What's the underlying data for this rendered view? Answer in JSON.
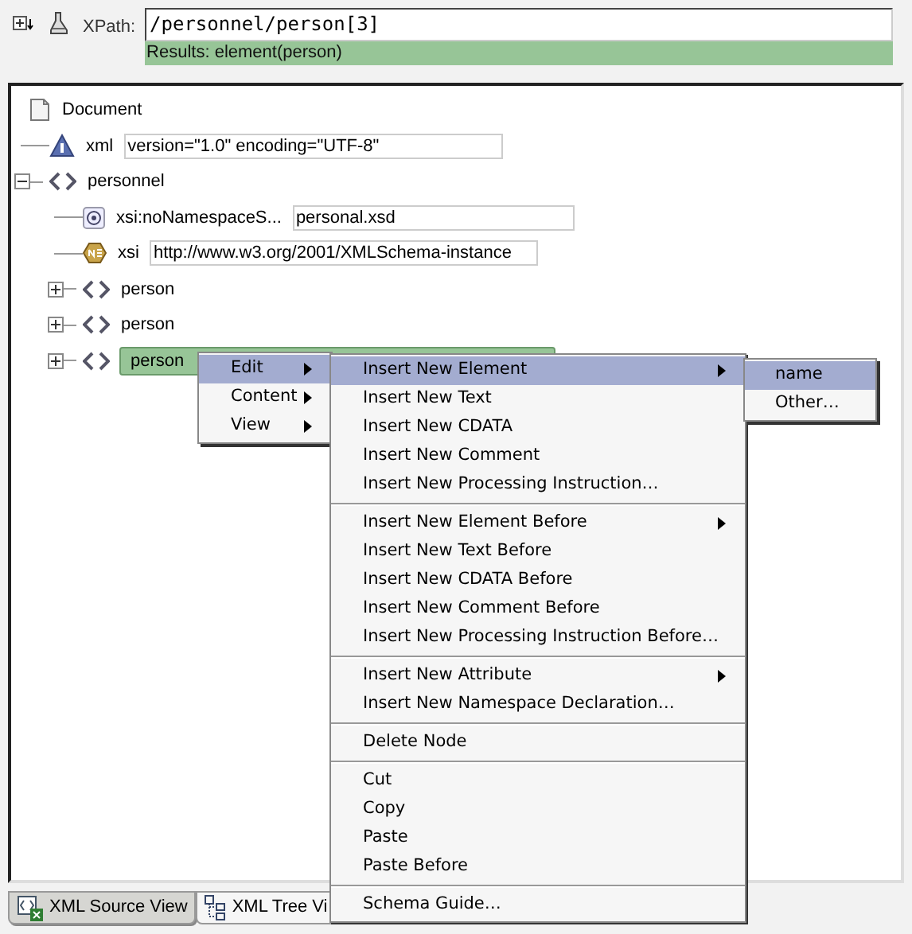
{
  "toolbar": {
    "xpath_label": "XPath:",
    "xpath_value": "/personnel/person[3]",
    "results": "Results: element(person)"
  },
  "tree": [
    {
      "kind": "document",
      "label": "Document",
      "selected": false,
      "children": [
        {
          "kind": "pi",
          "label": "xml",
          "value": "version=\"1.0\" encoding=\"UTF-8\"",
          "selected": false
        },
        {
          "kind": "element",
          "label": "personnel",
          "expanded": true,
          "selected": false,
          "children": [
            {
              "kind": "attribute",
              "label": "xsi:noNamespaceS...",
              "value": "personal.xsd",
              "selected": false
            },
            {
              "kind": "namespace",
              "label": "xsi",
              "value": "http://www.w3.org/2001/XMLSchema-instance",
              "selected": false
            },
            {
              "kind": "element",
              "label": "person",
              "expanded": false,
              "selected": false
            },
            {
              "kind": "element",
              "label": "person",
              "expanded": false,
              "selected": false
            },
            {
              "kind": "element",
              "label": "person",
              "expanded": false,
              "selected": true
            }
          ]
        }
      ]
    }
  ],
  "context_menu": [
    {
      "label": "Edit",
      "has_submenu": true,
      "selected": true
    },
    {
      "label": "Content",
      "has_submenu": true,
      "selected": false
    },
    {
      "label": "View",
      "has_submenu": true,
      "selected": false
    }
  ],
  "submenu": [
    {
      "label": "Insert New Element",
      "has_submenu": true,
      "selected": true,
      "separator_before": false
    },
    {
      "label": "Insert New Text",
      "has_submenu": false,
      "selected": false,
      "separator_before": false
    },
    {
      "label": "Insert New CDATA",
      "has_submenu": false,
      "selected": false,
      "separator_before": false
    },
    {
      "label": "Insert New Comment",
      "has_submenu": false,
      "selected": false,
      "separator_before": false
    },
    {
      "label": "Insert New Processing Instruction…",
      "has_submenu": false,
      "selected": false,
      "separator_before": false
    },
    {
      "label": "Insert New Element Before",
      "has_submenu": true,
      "selected": false,
      "separator_before": true
    },
    {
      "label": "Insert New Text Before",
      "has_submenu": false,
      "selected": false,
      "separator_before": false
    },
    {
      "label": "Insert New CDATA Before",
      "has_submenu": false,
      "selected": false,
      "separator_before": false
    },
    {
      "label": "Insert New Comment Before",
      "has_submenu": false,
      "selected": false,
      "separator_before": false
    },
    {
      "label": "Insert New Processing Instruction Before…",
      "has_submenu": false,
      "selected": false,
      "separator_before": false
    },
    {
      "label": "Insert New Attribute",
      "has_submenu": true,
      "selected": false,
      "separator_before": true
    },
    {
      "label": "Insert New Namespace Declaration…",
      "has_submenu": false,
      "selected": false,
      "separator_before": false
    },
    {
      "label": "Delete Node",
      "has_submenu": false,
      "selected": false,
      "separator_before": true
    },
    {
      "label": "Cut",
      "has_submenu": false,
      "selected": false,
      "separator_before": true
    },
    {
      "label": "Copy",
      "has_submenu": false,
      "selected": false,
      "separator_before": false
    },
    {
      "label": "Paste",
      "has_submenu": false,
      "selected": false,
      "separator_before": false
    },
    {
      "label": "Paste Before",
      "has_submenu": false,
      "selected": false,
      "separator_before": false
    },
    {
      "label": "Schema Guide…",
      "has_submenu": false,
      "selected": false,
      "separator_before": true
    }
  ],
  "element_menu": [
    {
      "label": "name",
      "selected": true
    },
    {
      "label": "Other…",
      "selected": false
    }
  ],
  "tabs": [
    {
      "label": "XML Source View",
      "selected": true
    },
    {
      "label": "XML Tree Vi",
      "selected": false
    }
  ]
}
